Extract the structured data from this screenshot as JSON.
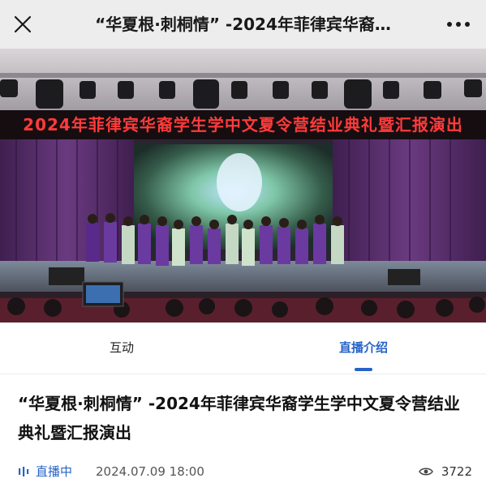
{
  "nav": {
    "title": "“华夏根·刺桐情” -2024年菲律宾华裔…",
    "close_icon": "close-icon",
    "more_icon": "more-dots-icon"
  },
  "video": {
    "banner_text": "2024年菲律宾华裔学生学中文夏令营结业典礼暨汇报演出",
    "content": "stage performance"
  },
  "tabs": [
    {
      "label": "互动",
      "active": false
    },
    {
      "label": "直播介绍",
      "active": true
    }
  ],
  "event": {
    "title": "“华夏根·刺桐情” -2024年菲律宾华裔学生学中文夏令营结业典礼暨汇报演出",
    "status_label": "直播中",
    "datetime": "2024.07.09 18:00",
    "view_count": "3722"
  },
  "colors": {
    "accent": "#2763c7",
    "nav_bg": "#ededed",
    "banner_red": "#ff3b3b",
    "curtain": "#5a2f6e"
  }
}
